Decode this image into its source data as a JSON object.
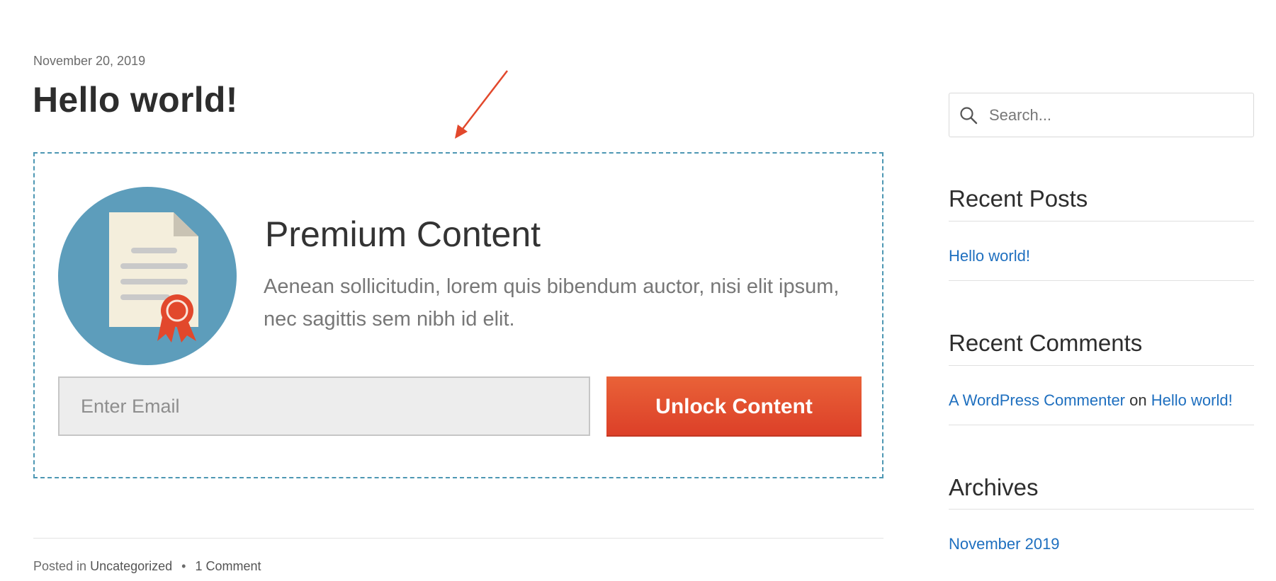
{
  "post": {
    "date": "November 20, 2019",
    "title": "Hello world!",
    "meta_prefix": "Posted in",
    "category": "Uncategorized",
    "separator": "•",
    "comments": "1 Comment"
  },
  "optin": {
    "headline": "Premium Content",
    "text": "Aenean sollicitudin, lorem quis bibendum auctor, nisi elit ipsum, nec sagittis sem nibh id elit.",
    "email_placeholder": "Enter Email",
    "button_label": "Unlock Content",
    "icon": "certificate-document-icon",
    "colors": {
      "border": "#4d97b3",
      "icon_circle": "#5d9dbb",
      "button": "#e2482c"
    }
  },
  "annotation": {
    "icon": "red-arrow-icon",
    "color": "#e2482c"
  },
  "sidebar": {
    "search_placeholder": "Search...",
    "recent_posts": {
      "title": "Recent Posts",
      "items": [
        "Hello world!"
      ]
    },
    "recent_comments": {
      "title": "Recent Comments",
      "author": "A WordPress Commenter",
      "on": "on",
      "post": "Hello world!"
    },
    "archives": {
      "title": "Archives",
      "items": [
        "November 2019"
      ]
    },
    "link_color": "#1e6fbf"
  }
}
